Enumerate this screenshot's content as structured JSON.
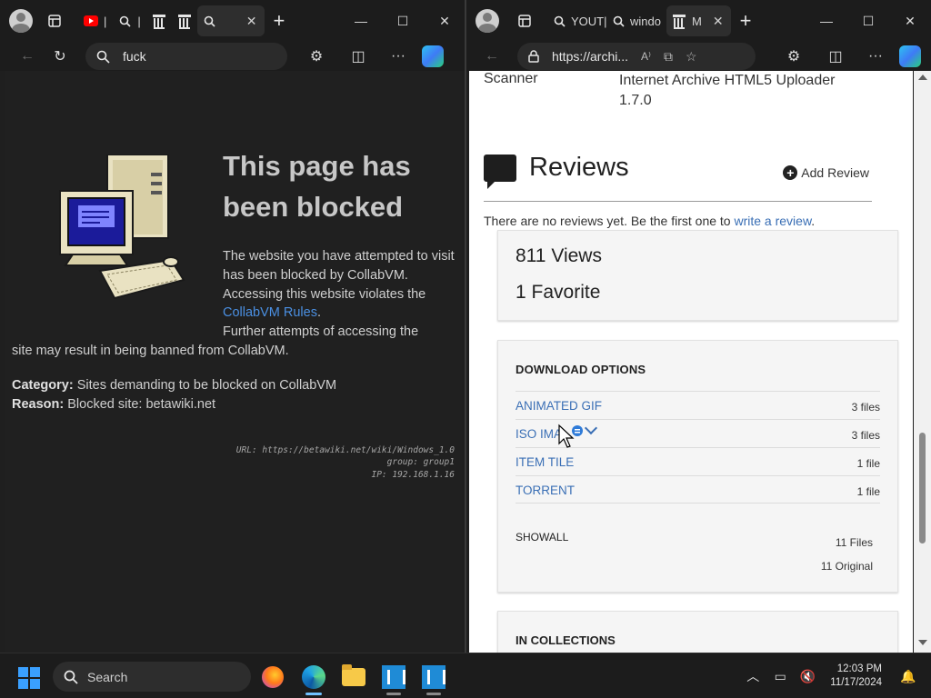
{
  "left_window": {
    "tabs": [
      {
        "label": "",
        "icon": "tab-actions-icon"
      },
      {
        "label": "",
        "icon": "youtube-icon"
      },
      {
        "label": "",
        "icon": "search-icon"
      },
      {
        "label": "",
        "icon": "archive-icon"
      },
      {
        "label": "",
        "icon": "archive-icon"
      },
      {
        "label": "",
        "icon": "search-icon",
        "active": true
      }
    ],
    "address": "fuck",
    "page": {
      "title": "This page has been blocked",
      "body_1": "The website you have attempted to visit has been blocked by CollabVM. Accessing this website violates the",
      "rules_link": "CollabVM Rules",
      "body_2": "Further attempts of accessing the",
      "body_3": "site may result in being banned from CollabVM.",
      "category_label": "Category:",
      "category_value": "Sites demanding to be blocked on CollabVM",
      "reason_label": "Reason:",
      "reason_value": "Blocked site: betawiki.net",
      "debug_url": "URL: https://betawiki.net/wiki/Windows_1.0",
      "debug_group": "group: group1",
      "debug_ip": "IP: 192.168.1.16"
    }
  },
  "right_window": {
    "tabs": [
      {
        "label": "",
        "icon": "tab-actions-icon"
      },
      {
        "label": "YOUT|",
        "icon": "search-icon"
      },
      {
        "label": "windo",
        "icon": "search-icon"
      },
      {
        "label": "M",
        "icon": "archive-icon",
        "active": true
      }
    ],
    "address": "https://archi...",
    "page": {
      "scanner_label": "Scanner",
      "scanner_value": "Internet Archive HTML5 Uploader 1.7.0",
      "reviews_title": "Reviews",
      "add_review": "Add Review",
      "no_reviews_text": "There are no reviews yet. Be the first one to",
      "write_review_link": "write a review",
      "period": ".",
      "views": "811 Views",
      "favorites": "1 Favorite",
      "download_heading": "DOWNLOAD OPTIONS",
      "downloads": [
        {
          "name": "ANIMATED GIF",
          "count": "3 files"
        },
        {
          "name": "ISO IMA",
          "count": "3 files"
        },
        {
          "name": "ITEM TILE",
          "count": "1 file"
        },
        {
          "name": "TORRENT",
          "count": "1 file"
        }
      ],
      "show_all": "SHOWALL",
      "total_files": "11 Files",
      "total_original": "11 Original",
      "collections_heading": "IN COLLECTIONS"
    }
  },
  "taskbar": {
    "search_placeholder": "Search",
    "time": "12:03 PM",
    "date": "11/17/2024"
  },
  "colors": {
    "link_dark": "#4a8fe2",
    "link_light": "#3a6fb5",
    "accent_windows": "#3aa0ff"
  }
}
